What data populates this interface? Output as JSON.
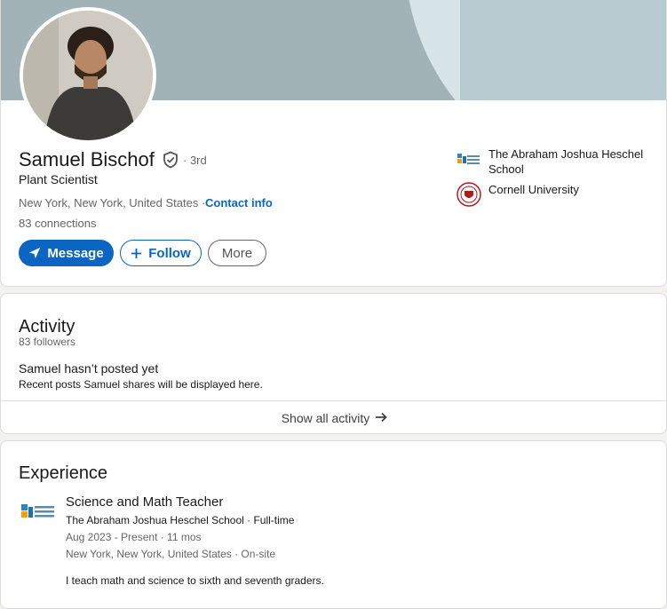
{
  "profile": {
    "name": "Samuel Bischof",
    "degree": "· 3rd",
    "headline": "Plant Scientist",
    "location": "New York, New York, United States ·",
    "contact_label": "Contact info",
    "connections": "83 connections",
    "buttons": {
      "message": "Message",
      "follow": "Follow",
      "more": "More"
    },
    "affiliations": [
      {
        "name": "The Abraham Joshua Heschel School",
        "icon": "heschel-school-logo"
      },
      {
        "name": "Cornell University",
        "icon": "cornell-seal-logo"
      }
    ]
  },
  "activity": {
    "title": "Activity",
    "followers": "83 followers",
    "empty_title": "Samuel hasn’t posted yet",
    "empty_subtitle": "Recent posts Samuel shares will be displayed here.",
    "show_all": "Show all activity"
  },
  "experience": {
    "title": "Experience",
    "items": [
      {
        "role": "Science and Math Teacher",
        "company": "The Abraham Joshua Heschel School · Full-time",
        "dates": "Aug 2023 - Present · 11 mos",
        "location": "New York, New York, United States · On-site",
        "description": "I teach math and science to sixth and seventh graders."
      }
    ]
  },
  "colors": {
    "accent": "#0a66c2",
    "banner": "#a2b3b7",
    "page_bg": "#f3f2ef"
  }
}
